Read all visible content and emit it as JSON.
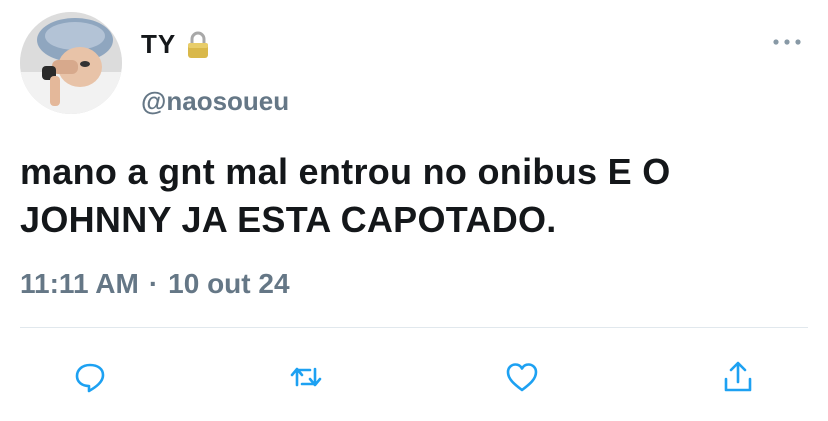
{
  "author": {
    "display_name": "TY",
    "handle": "@naosoueu",
    "protected_icon": "lock-icon",
    "avatar_icon": "avatar-photo"
  },
  "tweet": {
    "text": "mano a gnt mal entrou no onibus E O JOHNNY JA ESTA CAPOTADO.",
    "time": "11:11 AM",
    "separator": "·",
    "date": "10 out 24"
  },
  "actions": {
    "reply_icon": "reply-icon",
    "retweet_icon": "retweet-icon",
    "like_icon": "heart-icon",
    "share_icon": "share-icon",
    "more_icon": "more-icon"
  },
  "colors": {
    "text": "#14171a",
    "secondary": "#657786",
    "icon": "#1da1f2",
    "divider": "#e1e8ed"
  }
}
